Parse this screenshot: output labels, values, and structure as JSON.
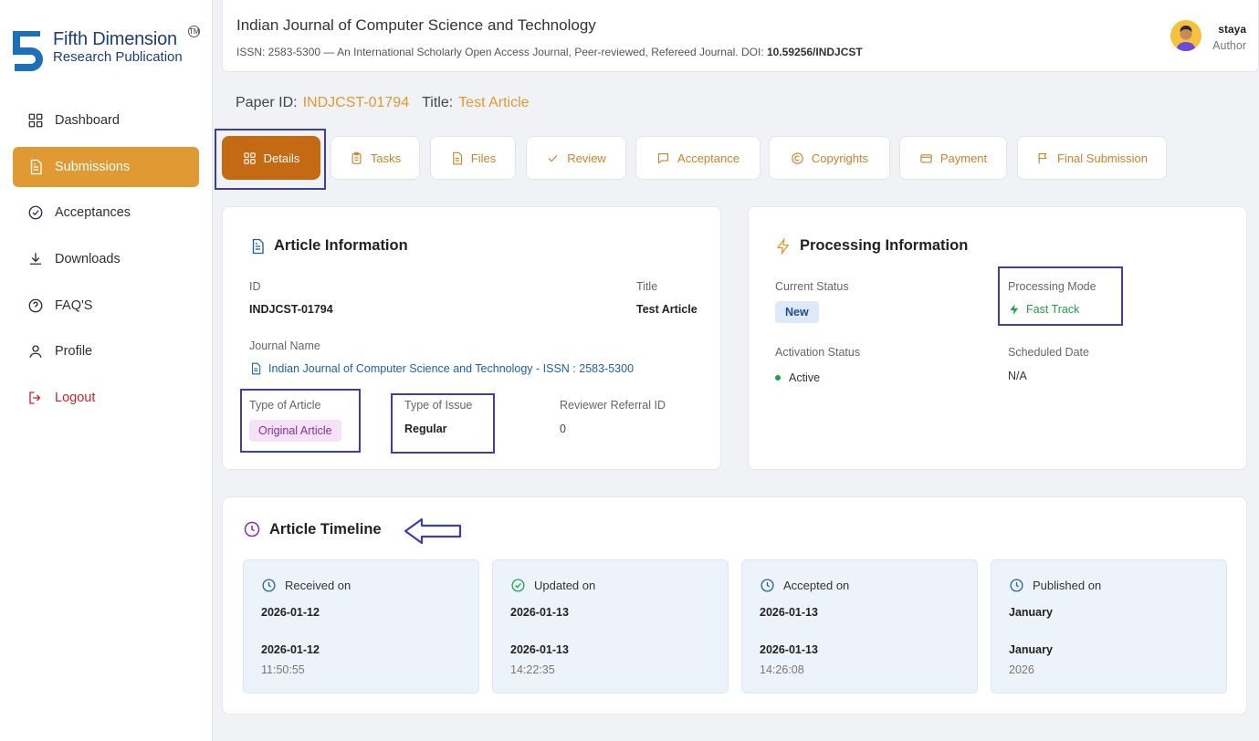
{
  "brand": {
    "line1": "Fifth Dimension",
    "line2": "Research Publication",
    "tm": "TM"
  },
  "sidebar": {
    "items": [
      {
        "label": "Dashboard",
        "icon": "grid-icon"
      },
      {
        "label": "Submissions",
        "icon": "document-icon"
      },
      {
        "label": "Acceptances",
        "icon": "check-circle-icon"
      },
      {
        "label": "Downloads",
        "icon": "download-icon"
      },
      {
        "label": "FAQ'S",
        "icon": "help-circle-icon"
      },
      {
        "label": "Profile",
        "icon": "user-icon"
      },
      {
        "label": "Logout",
        "icon": "logout-icon"
      }
    ],
    "active": "Submissions"
  },
  "header": {
    "title": "Indian Journal of Computer Science and Technology",
    "subtitle": "ISSN: 2583-5300 — An International Scholarly Open Access Journal, Peer-reviewed, Refereed Journal. DOI: ",
    "doi": "10.59256/INDJCST",
    "user_name": "staya",
    "user_role": "Author"
  },
  "paper": {
    "id_label": "Paper ID:",
    "id": "INDJCST-01794",
    "title_label": "Title:",
    "title": "Test Article"
  },
  "tabs": [
    {
      "label": "Details",
      "icon": "grid-icon",
      "active": true
    },
    {
      "label": "Tasks",
      "icon": "clipboard-icon"
    },
    {
      "label": "Files",
      "icon": "file-icon"
    },
    {
      "label": "Review",
      "icon": "check-icon"
    },
    {
      "label": "Acceptance",
      "icon": "message-icon"
    },
    {
      "label": "Copyrights",
      "icon": "copyright-icon"
    },
    {
      "label": "Payment",
      "icon": "credit-card-icon"
    },
    {
      "label": "Final Submission",
      "icon": "flag-icon"
    }
  ],
  "article": {
    "heading": "Article Information",
    "id_label": "ID",
    "id": "INDJCST-01794",
    "title_label": "Title",
    "title": "Test Article",
    "journal_label": "Journal Name",
    "journal": "Indian Journal of Computer Science and Technology - ISSN : 2583-5300",
    "type_label": "Type of Article",
    "type": "Original Article",
    "issue_label": "Type of Issue",
    "issue": "Regular",
    "ref_label": "Reviewer Referral ID",
    "ref": "0"
  },
  "processing": {
    "heading": "Processing Information",
    "status_label": "Current Status",
    "status": "New",
    "mode_label": "Processing Mode",
    "mode": "Fast Track",
    "activation_label": "Activation Status",
    "activation": "Active",
    "scheduled_label": "Scheduled Date",
    "scheduled": "N/A"
  },
  "timeline": {
    "heading": "Article Timeline",
    "items": [
      {
        "label": "Received on",
        "date": "2026-01-12",
        "date2": "2026-01-12",
        "time": "11:50:55",
        "icon": "clock-icon"
      },
      {
        "label": "Updated on",
        "date": "2026-01-13",
        "date2": "2026-01-13",
        "time": "14:22:35",
        "icon": "check-circle-icon"
      },
      {
        "label": "Accepted on",
        "date": "2026-01-13",
        "date2": "2026-01-13",
        "time": "14:26:08",
        "icon": "clock-icon"
      },
      {
        "label": "Published on",
        "date": "January",
        "date2": "January",
        "time": "2026",
        "icon": "clock-icon"
      }
    ]
  },
  "colors": {
    "accent": "#e09a33",
    "tab_active": "#c46a12",
    "annotation": "#3e3fa6",
    "link": "#1e5fa8",
    "success": "#22a046",
    "purple": "#8e2ba6"
  }
}
